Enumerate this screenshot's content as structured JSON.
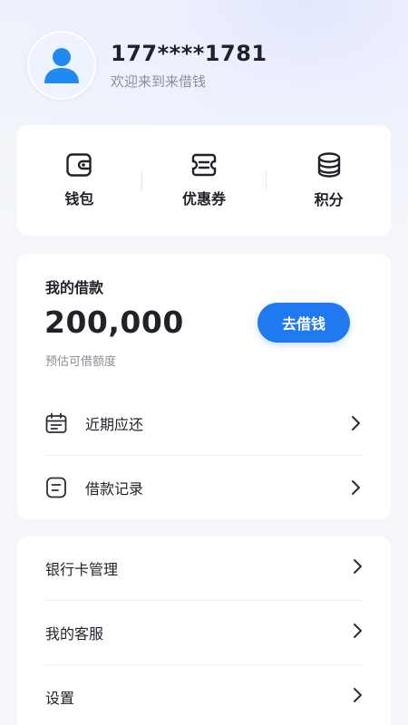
{
  "user": {
    "phone": "177****1781",
    "welcome": "欢迎来到来借钱",
    "avatar_icon": "user-icon"
  },
  "quick_actions": [
    {
      "label": "钱包",
      "icon": "wallet-icon"
    },
    {
      "label": "优惠券",
      "icon": "coupon-icon"
    },
    {
      "label": "积分",
      "icon": "coins-icon"
    }
  ],
  "loan": {
    "title": "我的借款",
    "amount": "200,000",
    "hint": "预估可借额度",
    "button_label": "去借钱",
    "rows": [
      {
        "label": "近期应还",
        "icon": "calendar-icon"
      },
      {
        "label": "借款记录",
        "icon": "record-icon"
      }
    ]
  },
  "settings": {
    "rows": [
      {
        "label": "银行卡管理"
      },
      {
        "label": "我的客服"
      },
      {
        "label": "设置"
      }
    ]
  },
  "colors": {
    "accent": "#1f7af2",
    "avatar": "#1f8af2",
    "text": "#1f2329",
    "muted": "#8a8f99"
  }
}
